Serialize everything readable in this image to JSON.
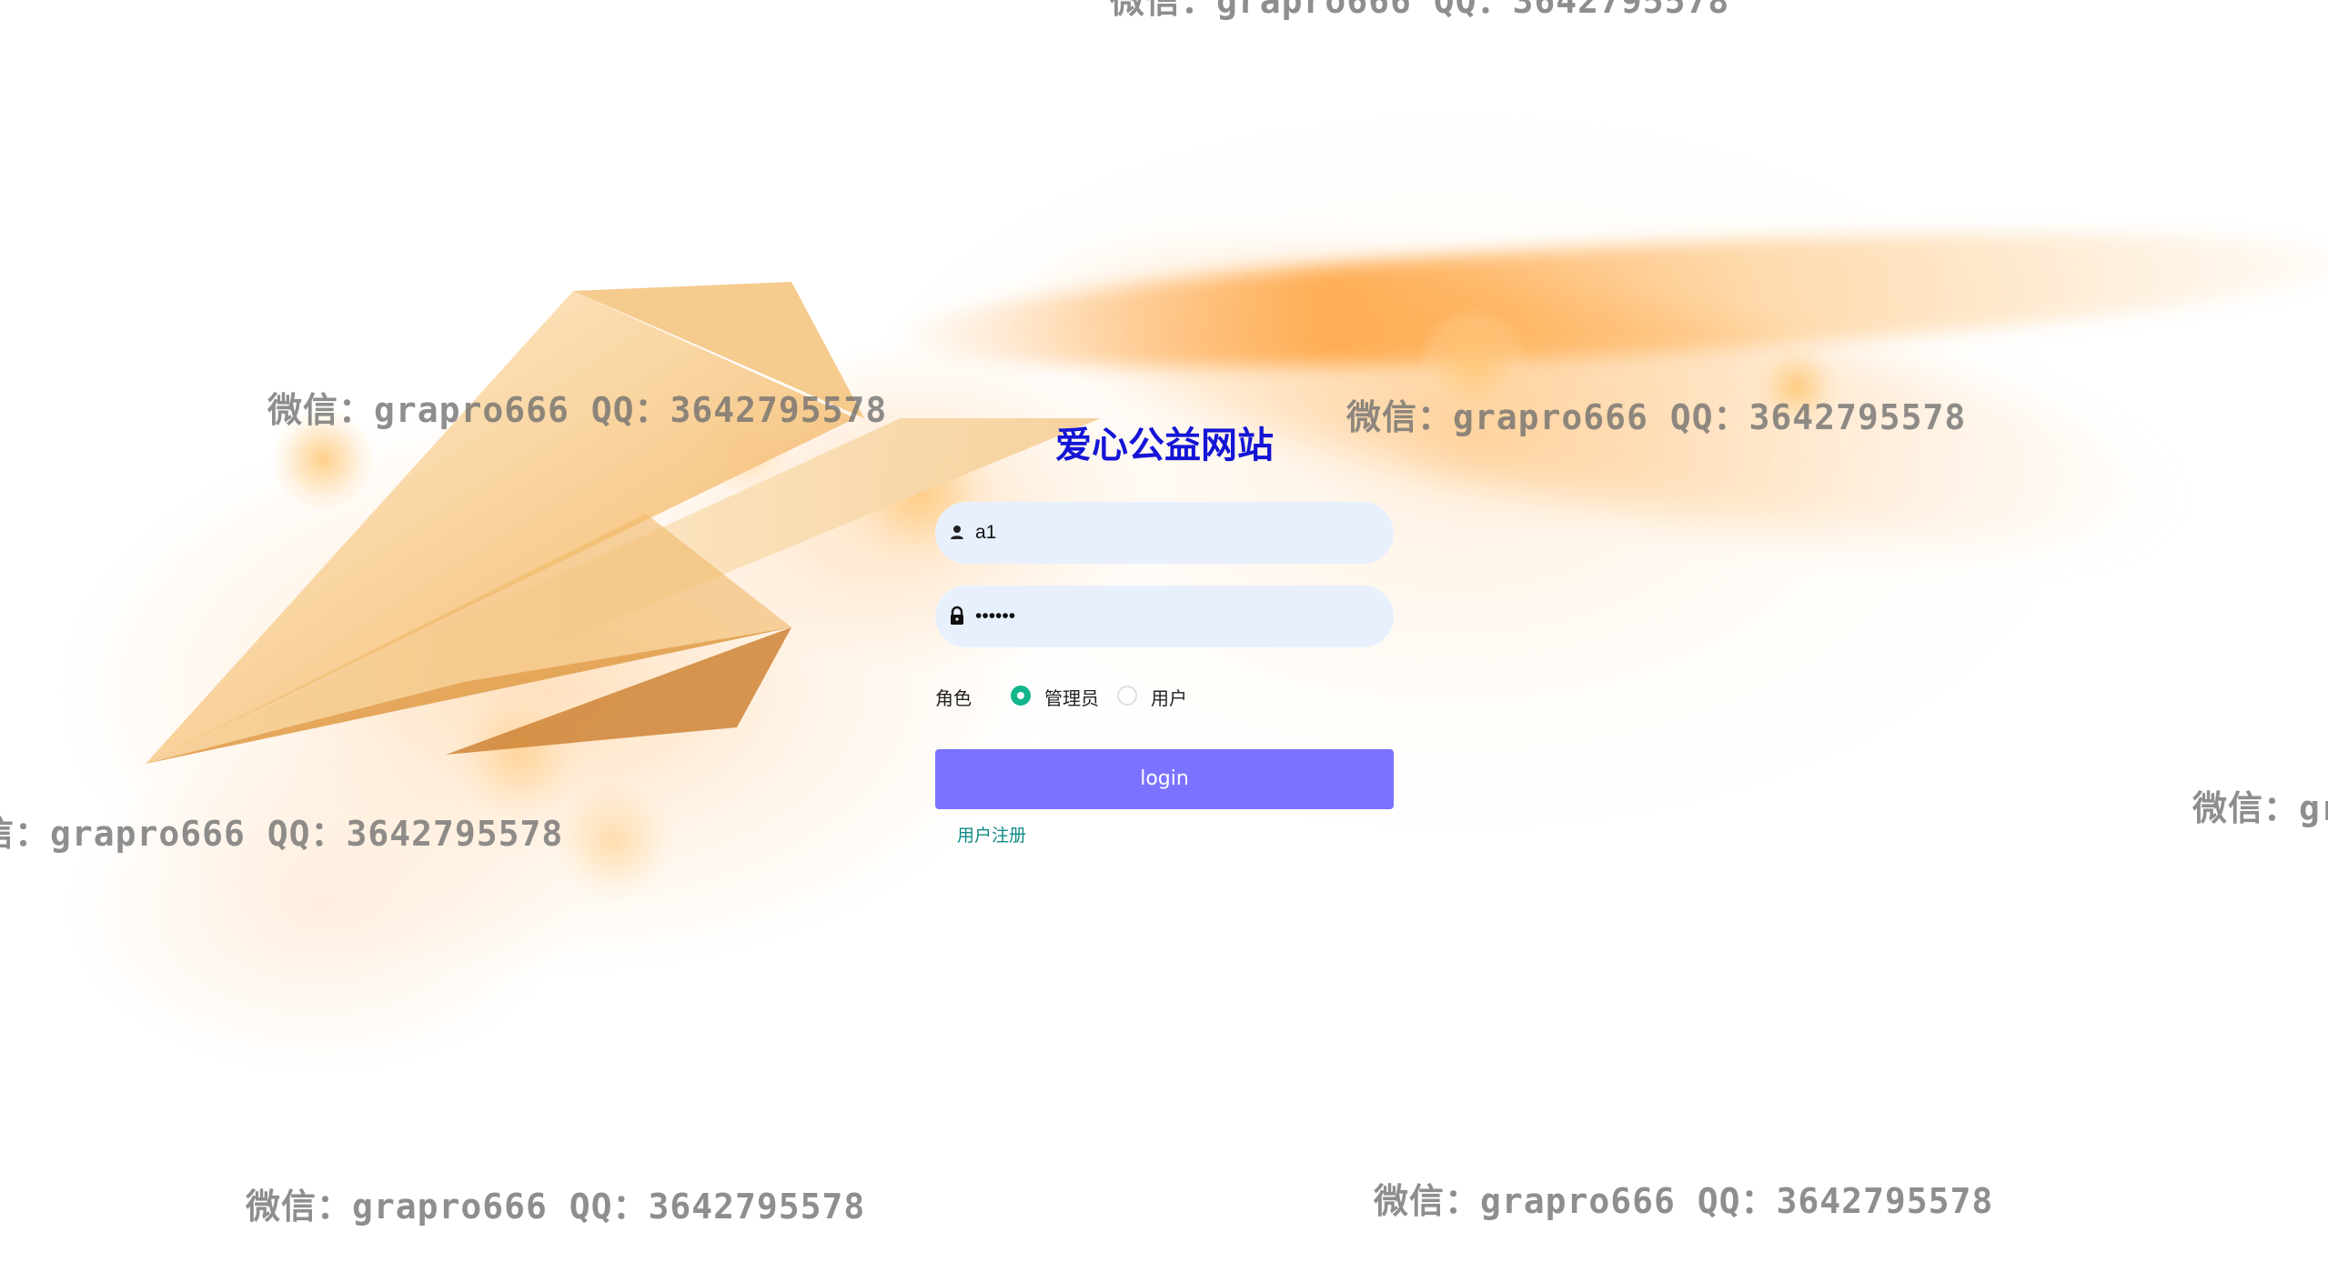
{
  "site_title": "爱心公益网站",
  "username_field": {
    "value": "a1",
    "icon": "user-icon"
  },
  "password_field": {
    "value": "123456",
    "icon": "lock-icon"
  },
  "role": {
    "label": "角色",
    "options": [
      "管理员",
      "用户"
    ],
    "selected": "管理员"
  },
  "login_button": {
    "label": "login"
  },
  "register_link": {
    "label": "用户注册"
  },
  "watermark_text": "微信：grapro666 QQ：3642795578",
  "colors": {
    "title": "#1515d6",
    "button": "#7b73ff",
    "radio_checked": "#12b58a",
    "link": "#0f8a86",
    "field_bg": "#e8f0fe"
  }
}
